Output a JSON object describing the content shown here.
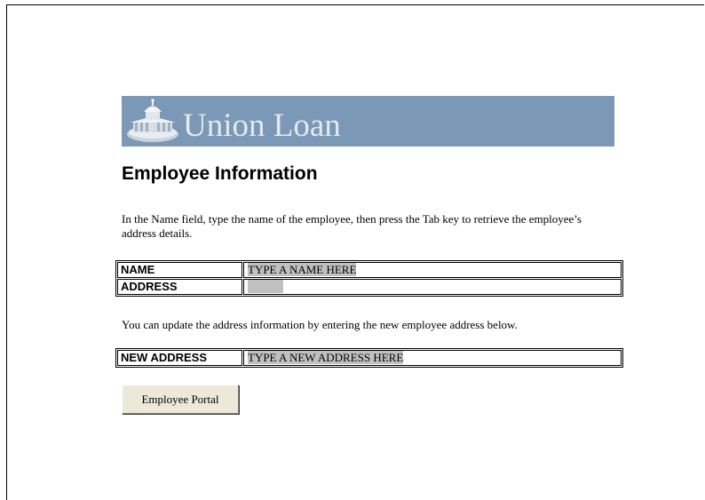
{
  "banner": {
    "title": "Union Loan",
    "logo_icon": "capitol-building-icon",
    "background_color": "#7b98b6"
  },
  "page": {
    "title": "Employee Information",
    "instructions": "In the Name field, type the name of the employee, then press the Tab key to retrieve the employee’s address details.",
    "update_note": "You can update the address information by entering the new employee address below."
  },
  "lookup_form": {
    "name_label": "NAME",
    "name_value": "TYPE A NAME HERE",
    "address_label": "ADDRESS",
    "address_value": ""
  },
  "update_form": {
    "new_address_label": "NEW ADDRESS",
    "new_address_value": "TYPE A NEW ADDRESS HERE"
  },
  "actions": {
    "portal_button_label": "Employee Portal"
  },
  "colors": {
    "field_background": "#c0c0c0",
    "button_face": "#ece9d8"
  }
}
